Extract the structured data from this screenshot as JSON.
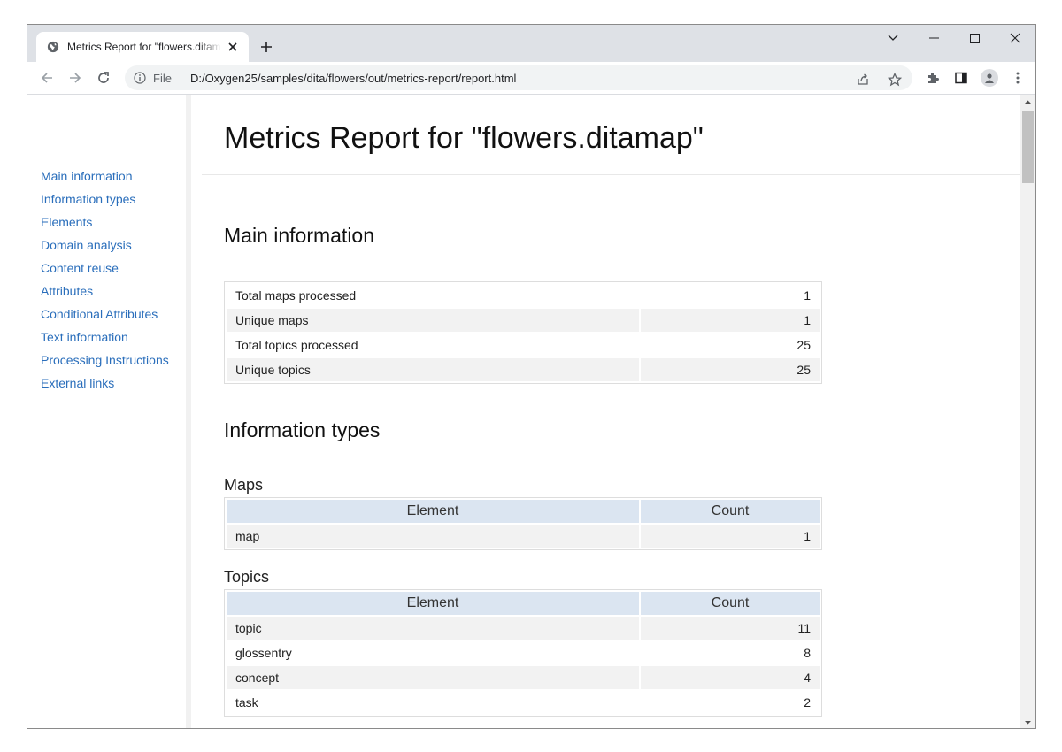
{
  "browser": {
    "tab_title": "Metrics Report for \"flowers.ditamap\"",
    "omnibox": {
      "scheme_label": "File",
      "url": "D:/Oxygen25/samples/dita/flowers/out/metrics-report/report.html"
    }
  },
  "sidebar": {
    "items": [
      {
        "label": "Main information"
      },
      {
        "label": "Information types"
      },
      {
        "label": "Elements"
      },
      {
        "label": "Domain analysis"
      },
      {
        "label": "Content reuse"
      },
      {
        "label": "Attributes"
      },
      {
        "label": "Conditional Attributes"
      },
      {
        "label": "Text information"
      },
      {
        "label": "Processing Instructions"
      },
      {
        "label": "External links"
      }
    ]
  },
  "page": {
    "title": "Metrics Report for \"flowers.ditamap\"",
    "main_information": {
      "heading": "Main information",
      "rows": [
        {
          "label": "Total maps processed",
          "value": "1"
        },
        {
          "label": "Unique maps",
          "value": "1"
        },
        {
          "label": "Total topics processed",
          "value": "25"
        },
        {
          "label": "Unique topics",
          "value": "25"
        }
      ]
    },
    "information_types": {
      "heading": "Information types",
      "maps": {
        "heading": "Maps",
        "col_element": "Element",
        "col_count": "Count",
        "rows": [
          {
            "element": "map",
            "count": "1"
          }
        ]
      },
      "topics": {
        "heading": "Topics",
        "col_element": "Element",
        "col_count": "Count",
        "rows": [
          {
            "element": "topic",
            "count": "11"
          },
          {
            "element": "glossentry",
            "count": "8"
          },
          {
            "element": "concept",
            "count": "4"
          },
          {
            "element": "task",
            "count": "2"
          }
        ]
      }
    }
  }
}
